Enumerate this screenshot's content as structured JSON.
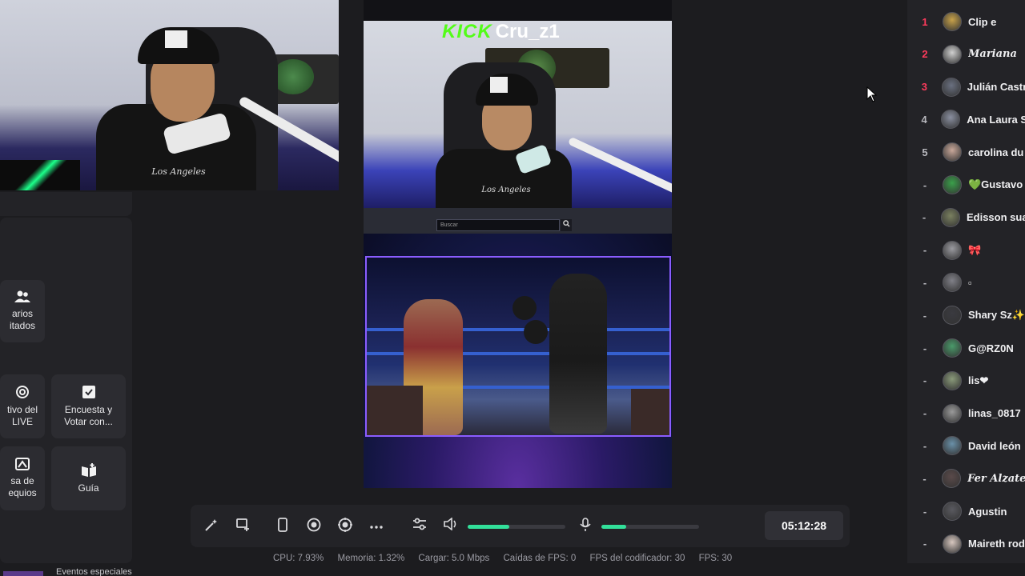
{
  "stream": {
    "platform_label": "KICK",
    "streamer_name": "Cru_z1",
    "search_placeholder": "Buscar",
    "search_icon": "magnifier-icon",
    "shirt_text": "Los Angeles"
  },
  "left_panel": {
    "tools": [
      {
        "icon": "users-icon",
        "label_line1": "arios",
        "label_line2": "itados"
      },
      {
        "icon": "target-icon",
        "label_line1": "tivo del",
        "label_line2": "LIVE"
      },
      {
        "icon": "poll-check-icon",
        "label_line1": "Encuesta y",
        "label_line2": "Votar con..."
      },
      {
        "icon": "teams-icon",
        "label_line1": "sa de",
        "label_line2": "equios"
      },
      {
        "icon": "guide-book-icon",
        "label_line1": "Guía",
        "label_line2": ""
      }
    ]
  },
  "controls": {
    "timer": "05:12:28",
    "volume_level": 0.43,
    "mic_level": 0.25,
    "accent_color": "#32e09a"
  },
  "stats": {
    "cpu": "CPU:  7.93%",
    "memory": "Memoria:  1.32%",
    "upload": "Cargar:  5.0 Mbps",
    "fps_drops": "Caídas de FPS:  0",
    "encoder_fps": "FPS del codificador:  30",
    "fps": "FPS:  30"
  },
  "bottom": {
    "label": "Eventos especiales"
  },
  "viewers": [
    {
      "rank": "1",
      "name": "Clip e",
      "top": true,
      "avatar_color": "#c8a24a"
    },
    {
      "rank": "2",
      "name": "Mariana",
      "top": true,
      "fancy": true,
      "avatar_color": "#d0d0d0"
    },
    {
      "rank": "3",
      "name": "Julián Castr",
      "top": true,
      "avatar_color": "#6a7080"
    },
    {
      "rank": "4",
      "name": "Ana Laura S",
      "avatar_color": "#8a8fa0"
    },
    {
      "rank": "5",
      "name": "carolina du",
      "avatar_color": "#c9a89a"
    },
    {
      "rank": "-",
      "name": "💚Gustavo",
      "avatar_color": "#3aa04a"
    },
    {
      "rank": "-",
      "name": "Edisson sua",
      "avatar_color": "#7a8060"
    },
    {
      "rank": "-",
      "name": "🎀",
      "avatar_color": "#9a9aa0"
    },
    {
      "rank": "-",
      "name": "▫",
      "avatar_color": "#808088"
    },
    {
      "rank": "-",
      "name": "Shary Sz✨",
      "avatar_color": "#3a3a40"
    },
    {
      "rank": "-",
      "name": "G@RZ0N",
      "avatar_color": "#4a9a6a"
    },
    {
      "rank": "-",
      "name": "lis❤",
      "avatar_color": "#8a9a7a"
    },
    {
      "rank": "-",
      "name": "linas_0817",
      "avatar_color": "#9a9a9a"
    },
    {
      "rank": "-",
      "name": "David león",
      "avatar_color": "#6a90a8"
    },
    {
      "rank": "-",
      "name": "Fer Alzate",
      "fancy": true,
      "avatar_color": "#5a4a4a"
    },
    {
      "rank": "-",
      "name": "Agustin",
      "avatar_color": "#5a5a60"
    },
    {
      "rank": "-",
      "name": "Maireth rod",
      "avatar_color": "#d8c8c0"
    }
  ]
}
